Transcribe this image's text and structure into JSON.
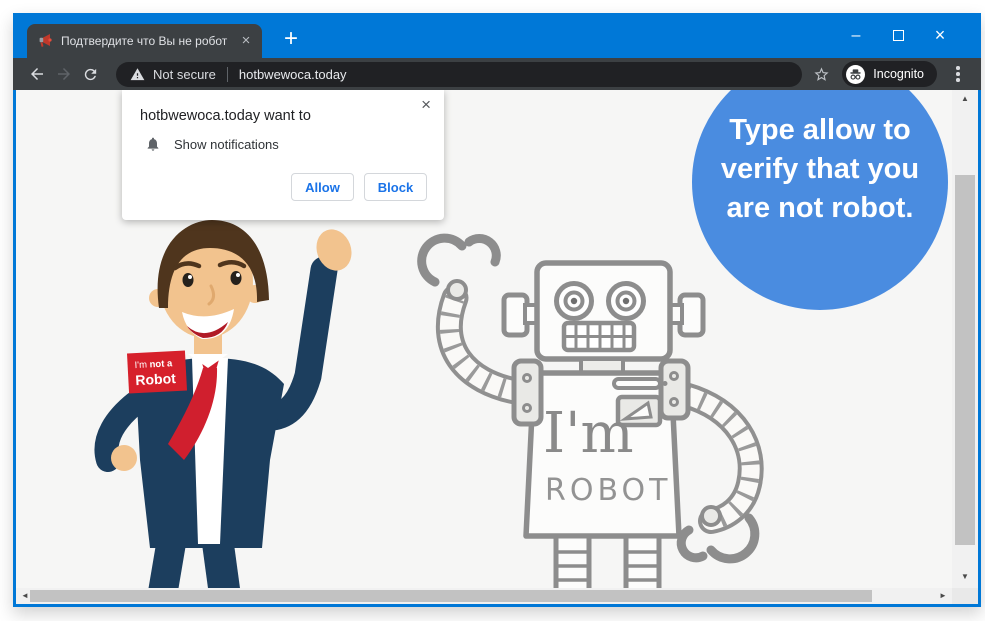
{
  "titlebar": {
    "tab_title": "Подтвердите что Вы не робот",
    "tab_close": "×",
    "new_tab": "+",
    "minimize": "–",
    "close": "×"
  },
  "toolbar": {
    "back": "←",
    "forward": "→",
    "security_label": "Not secure",
    "url": "hotbwewoca.today",
    "incognito_label": "Incognito"
  },
  "dialog": {
    "title": "hotbwewoca.today want to",
    "permission": "Show notifications",
    "allow": "Allow",
    "block": "Block",
    "close": "×"
  },
  "page": {
    "bubble_lines": [
      "Type allow to",
      "verify that you",
      "are not robot."
    ],
    "badge": {
      "line1_regular": "I'm ",
      "line1_bold": "not a",
      "line2": "Robot"
    },
    "robot_label": {
      "line1": "I'm",
      "line2": "ROBOT"
    }
  },
  "scrollbars": {
    "up": "▲",
    "down": "▼",
    "left": "◄",
    "right": "►"
  },
  "colors": {
    "titlebar_blue": "#0078d7",
    "toolbar_dark": "#3c4043",
    "omnibox_dark": "#202124",
    "bubble_blue": "#4a8ce0",
    "suit_navy": "#1c3e5e",
    "badge_red": "#d6202b",
    "tie_red": "#d01f2e",
    "button_text_blue": "#1a73e8",
    "page_background": "#f6f6f5"
  }
}
